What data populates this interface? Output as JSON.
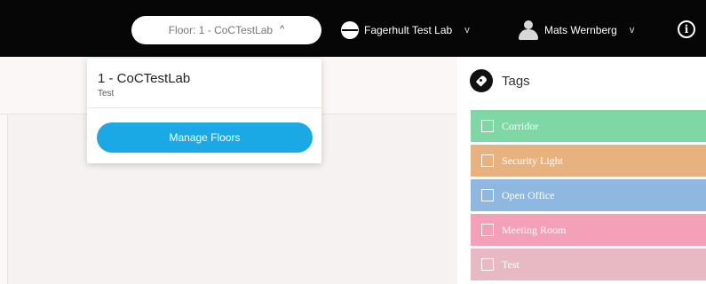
{
  "topbar": {
    "floor_selector": "Floor: 1 - CoCTestLab",
    "floor_chevron": "^",
    "organization": "Fagerhult Test Lab",
    "user": "Mats Wernberg",
    "caret": "v",
    "info": "i"
  },
  "dropdown": {
    "floor_name": "1 - CoCTestLab",
    "floor_description": "Test",
    "manage_button": "Manage Floors"
  },
  "tags": {
    "title": "Tags",
    "items": [
      {
        "label": "Corridor",
        "color": "#7ed7a4"
      },
      {
        "label": "Security Light",
        "color": "#e7b27f"
      },
      {
        "label": "Open Office",
        "color": "#8fb8e1"
      },
      {
        "label": "Meeting Room",
        "color": "#f3a0b8"
      },
      {
        "label": "Test",
        "color": "#e7b9c2"
      }
    ]
  },
  "icons": {
    "tags_icon": "tag-icon",
    "org_icon": "globe-icon",
    "user_icon": "avatar",
    "info_icon": "info-icon"
  }
}
